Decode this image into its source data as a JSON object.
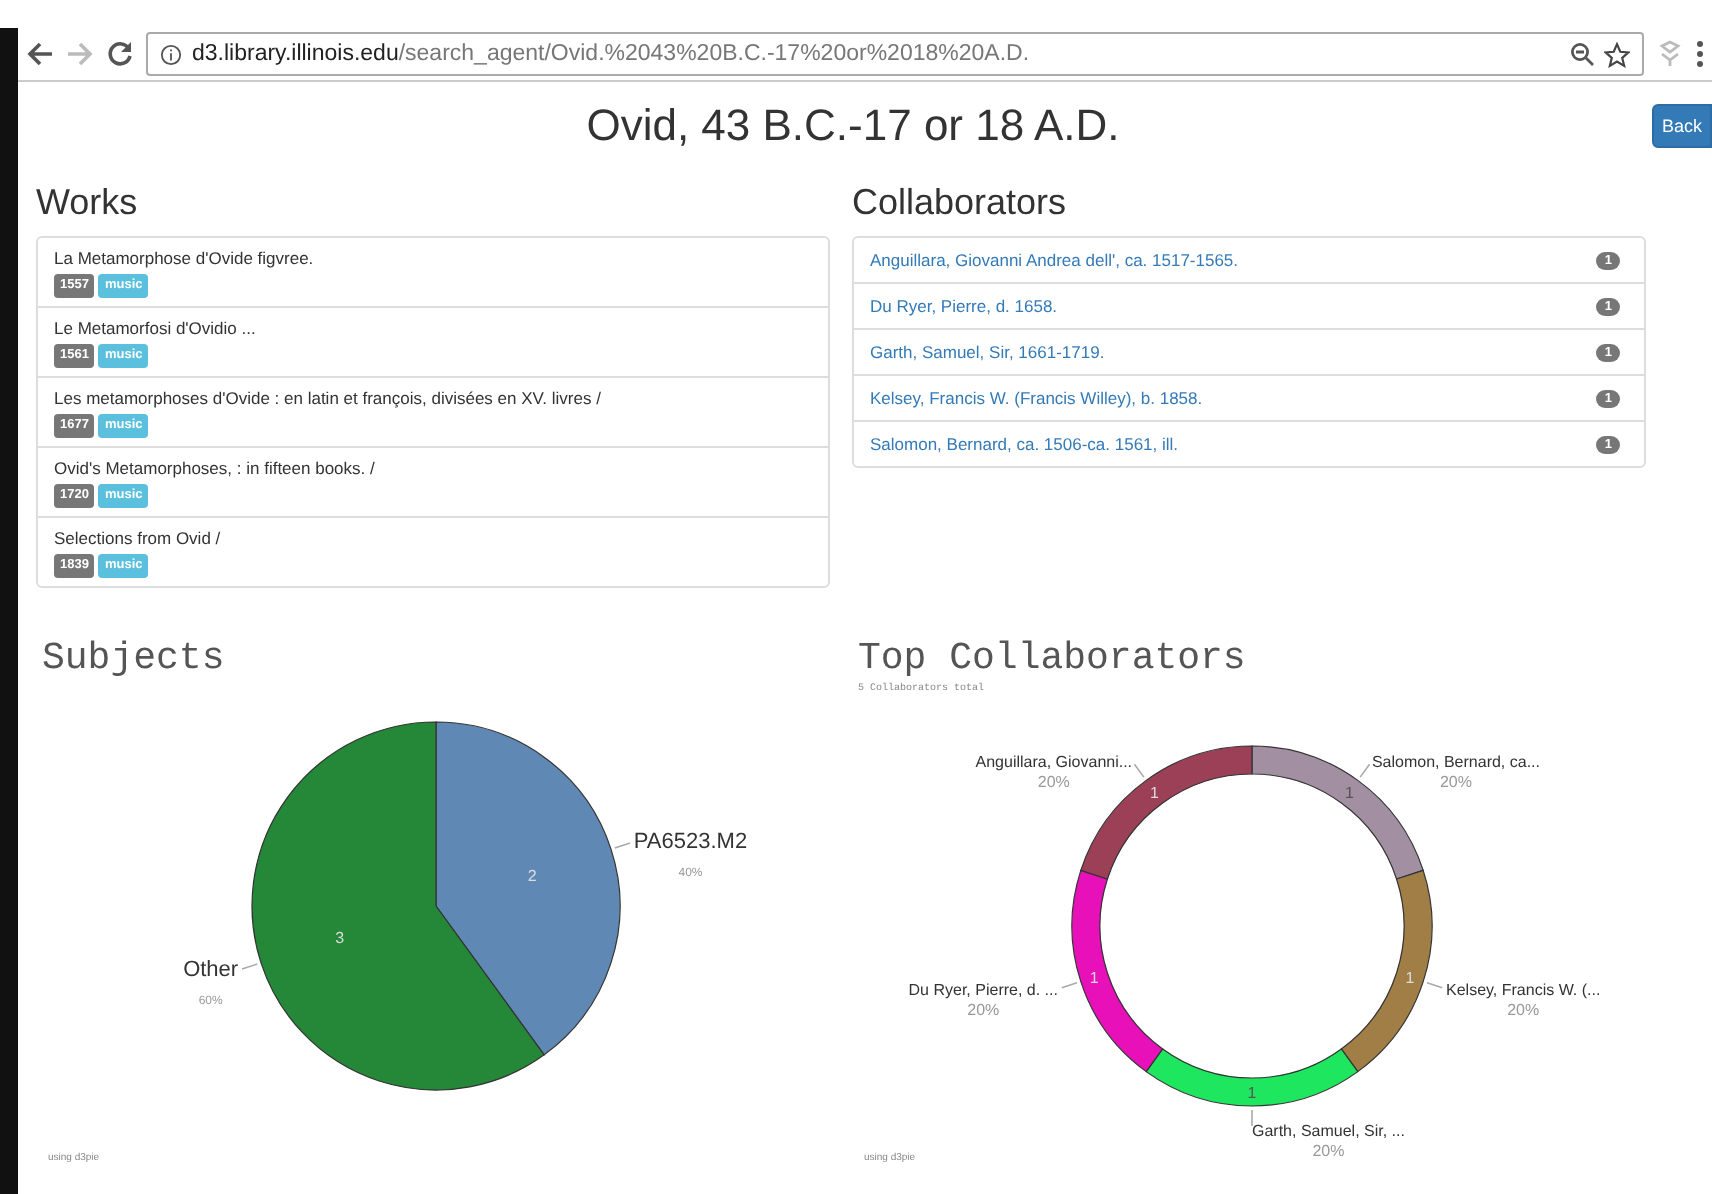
{
  "browser": {
    "url_host": "d3.library.illinois.edu",
    "url_path": "/search_agent/Ovid.%2043%20B.C.-17%20or%2018%20A.D."
  },
  "page": {
    "title": "Ovid, 43 B.C.-17 or 18 A.D.",
    "back_button": "Back"
  },
  "works": {
    "heading": "Works",
    "items": [
      {
        "title": "La Metamorphose d'Ovide figvree.",
        "year": "1557",
        "tag": "music"
      },
      {
        "title": "Le Metamorfosi d'Ovidio ...",
        "year": "1561",
        "tag": "music"
      },
      {
        "title": "Les metamorphoses d'Ovide : en latin et françois, divisées en XV. livres /",
        "year": "1677",
        "tag": "music"
      },
      {
        "title": "Ovid's Metamorphoses, : in fifteen books. /",
        "year": "1720",
        "tag": "music"
      },
      {
        "title": "Selections from Ovid /",
        "year": "1839",
        "tag": "music"
      }
    ]
  },
  "collaborators": {
    "heading": "Collaborators",
    "items": [
      {
        "name": "Anguillara, Giovanni Andrea dell', ca. 1517-1565.",
        "count": "1"
      },
      {
        "name": "Du Ryer, Pierre, d. 1658.",
        "count": "1"
      },
      {
        "name": "Garth, Samuel, Sir, 1661-1719.",
        "count": "1"
      },
      {
        "name": "Kelsey, Francis W. (Francis Willey), b. 1858.",
        "count": "1"
      },
      {
        "name": "Salomon, Bernard, ca. 1506-ca. 1561, ill.",
        "count": "1"
      }
    ]
  },
  "charts": [
    {
      "title": "Subjects",
      "footer": "using d3pie",
      "chart_data": {
        "type": "pie",
        "categories": [
          "PA6523.M2",
          "Other"
        ],
        "values": [
          2,
          3
        ],
        "colors": [
          "#6088b4",
          "#248838"
        ],
        "data_labels": true,
        "value_labels": [
          "2",
          "3"
        ],
        "annotations": [
          {
            "text": "40%"
          },
          {
            "text": "60%"
          }
        ]
      }
    },
    {
      "title": "Top Collaborators",
      "subtitle": "5 Collaborators total",
      "footer": "using d3pie",
      "chart_data": {
        "type": "donut",
        "categories": [
          "Salomon, Bernard, ca...",
          "Kelsey, Francis W. (...",
          "Garth, Samuel, Sir, ...",
          "Du Ryer, Pierre, d. ...",
          "Anguillara, Giovanni..."
        ],
        "values": [
          1,
          1,
          1,
          1,
          1
        ],
        "colors": [
          "#a38fa2",
          "#a07e45",
          "#1ee65f",
          "#e810b8",
          "#9b4057"
        ],
        "data_labels": true,
        "value_labels": [
          "1",
          "1",
          "1",
          "1",
          "1"
        ],
        "annotations": [
          {
            "text": "20%"
          },
          {
            "text": "20%"
          },
          {
            "text": "20%"
          },
          {
            "text": "20%"
          },
          {
            "text": "20%"
          }
        ]
      }
    }
  ]
}
